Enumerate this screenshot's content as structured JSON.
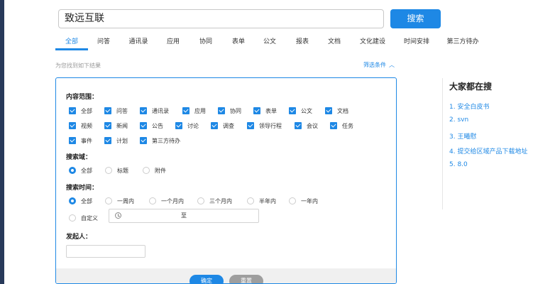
{
  "search": {
    "value": "致远互联",
    "button_label": "搜索"
  },
  "tabs": [
    {
      "label": "全部",
      "active": true
    },
    {
      "label": "问答"
    },
    {
      "label": "通讯录"
    },
    {
      "label": "应用"
    },
    {
      "label": "协同"
    },
    {
      "label": "表单"
    },
    {
      "label": "公文"
    },
    {
      "label": "报表"
    },
    {
      "label": "文档"
    },
    {
      "label": "文化建设"
    },
    {
      "label": "时间安排"
    },
    {
      "label": "第三方待办"
    }
  ],
  "results": {
    "hint": "为您找到如下结果",
    "filter_label": "筛选条件"
  },
  "filter": {
    "content_scope": {
      "label": "内容范围：",
      "options": [
        {
          "label": "全部",
          "checked": true
        },
        {
          "label": "问答",
          "checked": true
        },
        {
          "label": "通讯录",
          "checked": true
        },
        {
          "label": "应用",
          "checked": true
        },
        {
          "label": "协同",
          "checked": true
        },
        {
          "label": "表单",
          "checked": true
        },
        {
          "label": "公文",
          "checked": true
        },
        {
          "label": "文档",
          "checked": true
        },
        {
          "label": "视频",
          "checked": true
        },
        {
          "label": "新闻",
          "checked": true
        },
        {
          "label": "公告",
          "checked": true
        },
        {
          "label": "讨论",
          "checked": true
        },
        {
          "label": "调查",
          "checked": true
        },
        {
          "label": "领导行程",
          "checked": true
        },
        {
          "label": "会议",
          "checked": true
        },
        {
          "label": "任务",
          "checked": true
        },
        {
          "label": "事件",
          "checked": true
        },
        {
          "label": "计划",
          "checked": true
        },
        {
          "label": "第三方待办",
          "checked": true
        }
      ]
    },
    "search_field": {
      "label": "搜索域：",
      "options": [
        {
          "label": "全部",
          "selected": true
        },
        {
          "label": "标题"
        },
        {
          "label": "附件"
        }
      ]
    },
    "search_time": {
      "label": "搜索时间：",
      "options": [
        {
          "label": "全部",
          "selected": true
        },
        {
          "label": "一周内"
        },
        {
          "label": "一个月内"
        },
        {
          "label": "三个月内"
        },
        {
          "label": "半年内"
        },
        {
          "label": "一年内"
        },
        {
          "label": "自定义"
        }
      ],
      "range_separator": "至"
    },
    "initiator": {
      "label": "发起人：",
      "value": ""
    },
    "confirm_label": "确定",
    "reset_label": "重置"
  },
  "trending": {
    "title": "大家都在搜",
    "items": [
      "1. 安全白皮书",
      "2. svn",
      "3. 王曦慰",
      "4. 提交给区域产品下载地址",
      "5. 8.0"
    ]
  },
  "colors": {
    "accent": "#1e88e5",
    "sidebar": "#283a5a"
  }
}
